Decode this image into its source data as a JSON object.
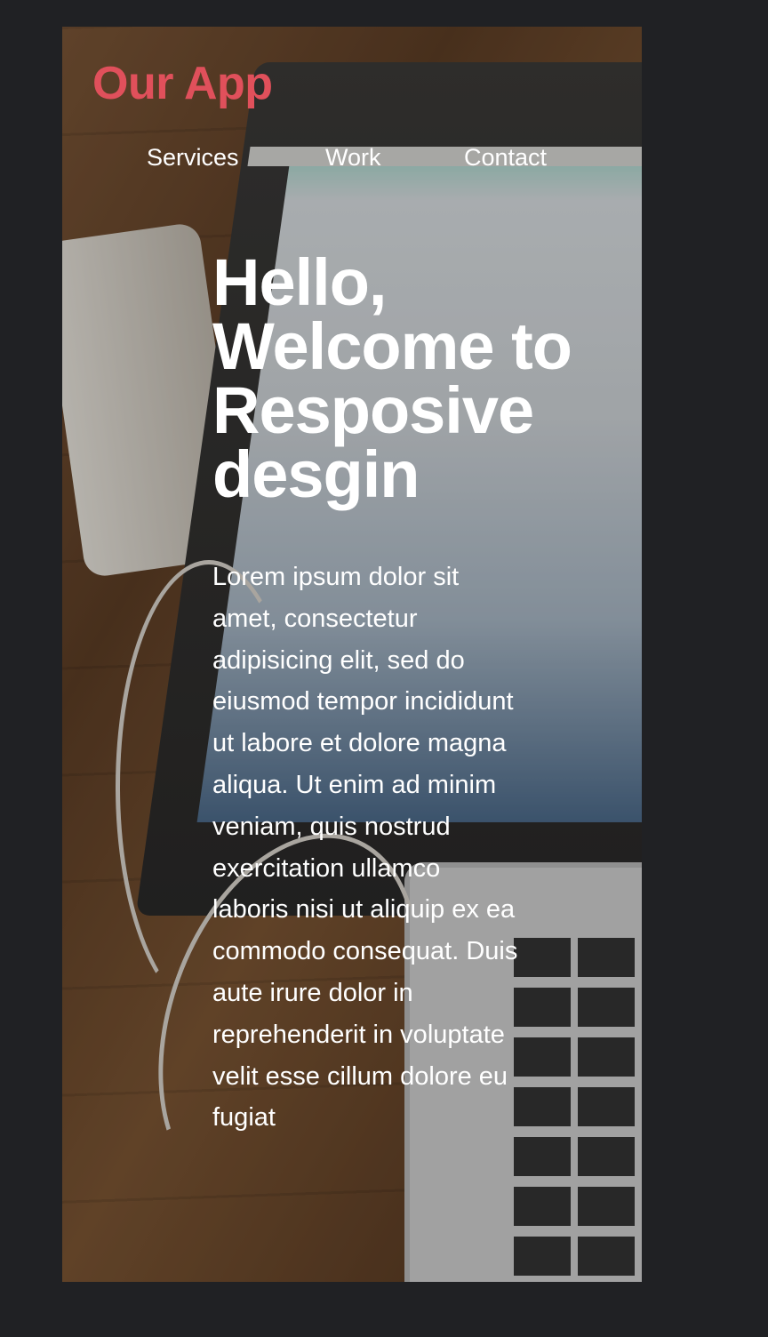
{
  "header": {
    "logo_text": "Our App"
  },
  "nav": {
    "items": [
      {
        "label": "Services"
      },
      {
        "label": "Work"
      },
      {
        "label": "Contact"
      }
    ]
  },
  "hero": {
    "title": "Hello, Welcome to Resposive desgin",
    "body": "Lorem ipsum dolor sit amet, consectetur adipisicing elit, sed do eiusmod tempor incididunt ut labore et dolore magna aliqua. Ut enim ad minim veniam, quis nostrud exercitation ullamco laboris nisi ut aliquip ex ea commodo consequat. Duis aute irure dolor in reprehenderit in voluptate velit esse cillum dolore eu fugiat"
  },
  "colors": {
    "logo": "#e0505b",
    "page_background": "#202124",
    "text": "#ffffff"
  }
}
